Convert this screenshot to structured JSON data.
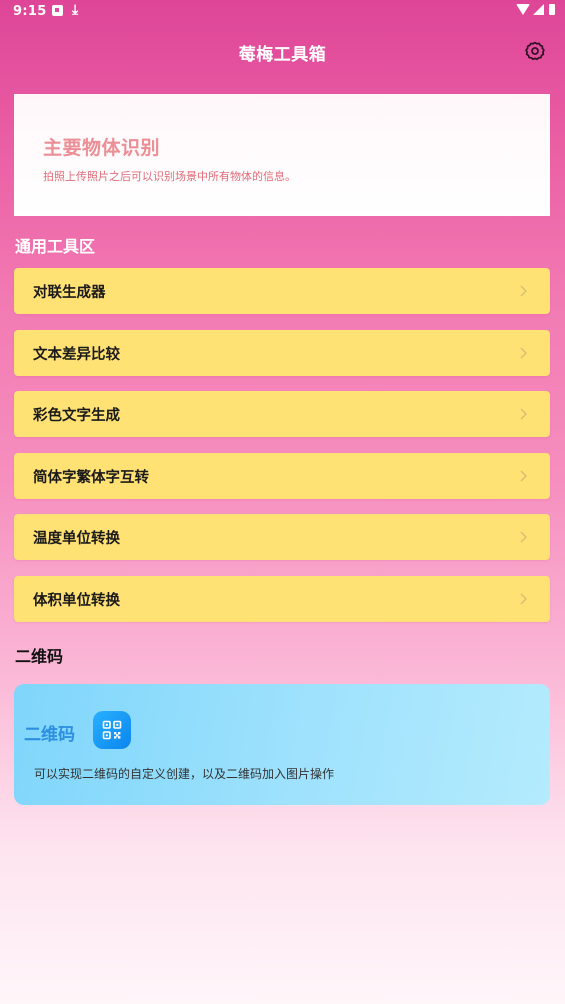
{
  "status_bar": {
    "time": "9:15",
    "download_glyph": "⤓",
    "icons": [
      "notification-icon",
      "download-icon",
      "wifi-icon",
      "signal-icon",
      "battery-icon"
    ]
  },
  "header": {
    "title": "莓梅工具箱",
    "settings_icon": "gear-icon"
  },
  "feature_card": {
    "title": "主要物体识别",
    "description": "拍照上传照片之后可以识别场景中所有物体的信息。"
  },
  "general_tools": {
    "section_title": "通用工具区",
    "items": [
      {
        "label": "对联生成器"
      },
      {
        "label": "文本差异比较"
      },
      {
        "label": "彩色文字生成"
      },
      {
        "label": "简体字繁体字互转"
      },
      {
        "label": "温度单位转换"
      },
      {
        "label": "体积单位转换"
      }
    ]
  },
  "qr_section": {
    "section_title": "二维码",
    "card": {
      "title": "二维码",
      "icon": "qr-code-icon",
      "description": "可以实现二维码的自定义创建，以及二维码加入图片操作"
    }
  },
  "colors": {
    "header_pink": "#de4597",
    "tool_item_yellow": "#ffe174",
    "feature_title_pink": "#ec8e95",
    "qr_card_blue": "#9fe2fd",
    "qr_title_blue": "#2d8fe0",
    "qr_icon_blue": "#0a86ee"
  }
}
